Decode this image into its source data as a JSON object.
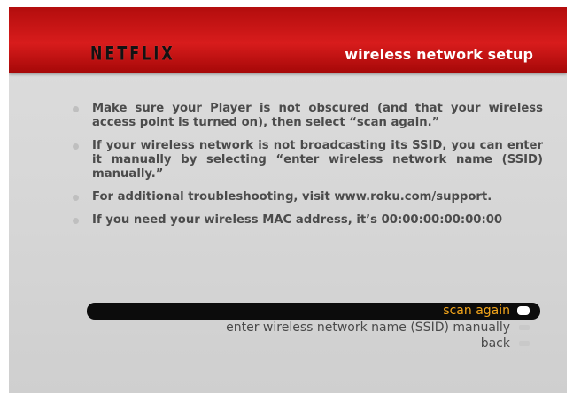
{
  "header": {
    "logo_text": "NETFLIX",
    "title": "wireless network setup"
  },
  "instructions": [
    {
      "text": "Make sure your Player is not obscured (and that your wireless access point is turned on), then select “scan again.”"
    },
    {
      "text": "If your wireless network is not broadcasting its SSID, you can enter it manually by selecting “enter wireless network name (SSID) manually.”"
    },
    {
      "text": "For additional troubleshooting, visit www.roku.com/support."
    },
    {
      "text": "If you need your wireless MAC address, it’s 00:00:00:00:00:00"
    }
  ],
  "menu": {
    "items": [
      {
        "label": "scan again",
        "selected": true
      },
      {
        "label": "enter wireless network name (SSID) manually",
        "selected": false
      },
      {
        "label": "back",
        "selected": false
      }
    ]
  },
  "colors": {
    "header_red": "#d81c1c",
    "background_gray": "#d8d8d8",
    "selected_text": "#f3a51b",
    "body_text": "#4b4b4b"
  }
}
